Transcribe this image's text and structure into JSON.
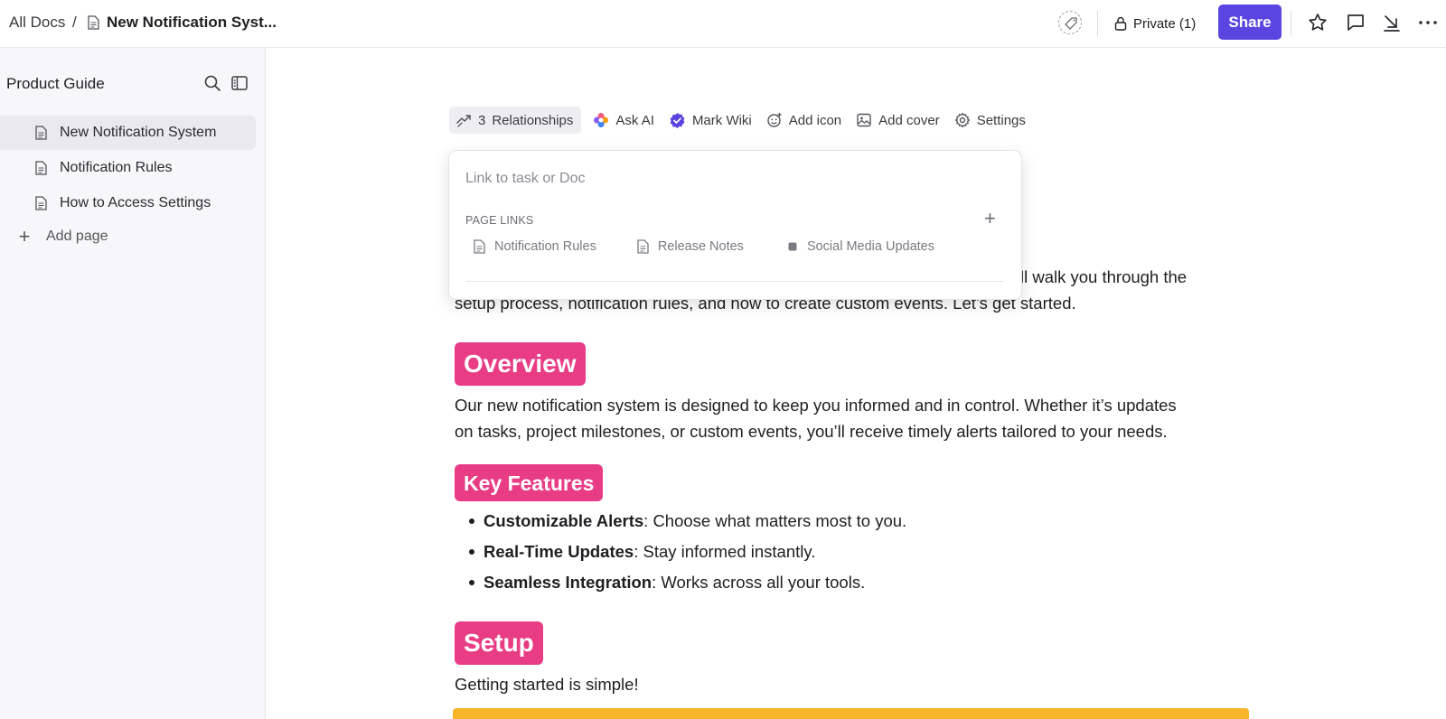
{
  "topbar": {
    "breadcrumb_root": "All Docs",
    "breadcrumb_sep": "/",
    "breadcrumb_doc": "New Notification Syst...",
    "privacy_label": "Private (1)",
    "share_label": "Share",
    "icons": [
      "tag-icon",
      "lock-icon",
      "star-icon",
      "comment-icon",
      "collapse-arrow-icon",
      "more-icon"
    ],
    "accent_color": "#5b45e0"
  },
  "sidebar": {
    "title": "Product Guide",
    "items": [
      {
        "label": "New Notification System",
        "active": true
      },
      {
        "label": "Notification Rules",
        "active": false
      },
      {
        "label": "How to Access Settings",
        "active": false
      }
    ],
    "add_page_label": "Add page",
    "plus_glyph": "+"
  },
  "doc_toolbar": {
    "relationships_count": "3",
    "relationships_label": "Relationships",
    "ask_ai_label": "Ask AI",
    "mark_wiki_label": "Mark Wiki",
    "add_icon_label": "Add icon",
    "add_cover_label": "Add cover",
    "settings_label": "Settings"
  },
  "relationships_popover": {
    "search_placeholder": "Link to task or Doc",
    "section_title": "PAGE LINKS",
    "plus_glyph": "+",
    "links": [
      {
        "label": "Notification Rules",
        "icon": "doc-icon"
      },
      {
        "label": "Release Notes",
        "icon": "doc-icon"
      },
      {
        "label": "Social Media Updates",
        "icon": "square-icon"
      }
    ]
  },
  "document": {
    "intro_line1_tail": "ll walk you through the",
    "intro_line2": "setup process, notification rules, and how to create custom events. Let’s get started.",
    "overview_heading": "Overview",
    "overview_line1": "Our new notification system is designed to keep you informed and in control. Whether it’s updates",
    "overview_line2": "on tasks, project milestones, or custom events, you’ll receive timely alerts tailored to your needs.",
    "key_features_heading": "Key Features",
    "features": [
      {
        "title": "Customizable Alerts",
        "desc": ": Choose what matters most to you."
      },
      {
        "title": "Real-Time Updates",
        "desc": ": Stay informed instantly."
      },
      {
        "title": "Seamless Integration",
        "desc": ": Works across all your tools."
      }
    ],
    "setup_heading": "Setup",
    "setup_text": "Getting started is simple!",
    "heading_color": "#e83c85",
    "callout_color": "#f7b52b"
  }
}
